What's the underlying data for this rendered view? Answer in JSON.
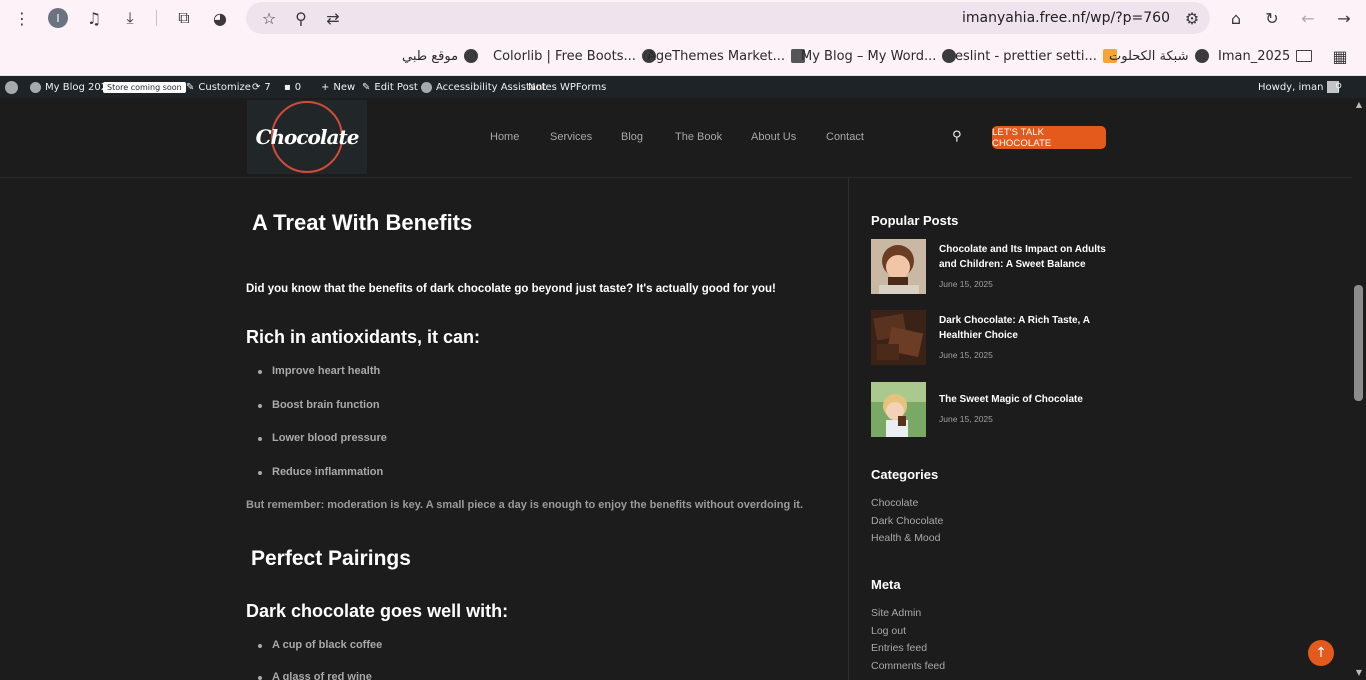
{
  "browser": {
    "profile_initial": "I",
    "url": "imanyahia.free.nf/wp/?p=760",
    "icons": [
      "menu-icon",
      "profile-icon",
      "media-icon",
      "download-icon",
      "extensions-icon",
      "globe-extension-icon",
      "star-icon",
      "zoom-icon",
      "translate-icon",
      "site-settings-icon",
      "home-icon",
      "reload-icon",
      "back-icon",
      "forward-icon",
      "apps-grid-icon"
    ]
  },
  "bookmarks": [
    {
      "label": "موقع طبي"
    },
    {
      "label": "Colorlib | Free Boots..."
    },
    {
      "label": "AgeThemes Market..."
    },
    {
      "label": "My Blog – My Word..."
    },
    {
      "label": "eslint - prettier setti..."
    },
    {
      "label": "شبكة الكحلوت"
    },
    {
      "label": "Iman_2025"
    }
  ],
  "adminbar": {
    "site_name": "My Blog 2025",
    "store_badge": "Store coming soon",
    "customize": "Customize",
    "updates_count": "7",
    "comments_count": "0",
    "new": "New",
    "edit_post": "Edit Post",
    "accessibility": "Accessibility Assistant",
    "notes": "Notes",
    "wpforms": "WPForms",
    "howdy": "Howdy, iman"
  },
  "header": {
    "logo_text": "Chocolate",
    "nav": [
      "Home",
      "Services",
      "Blog",
      "The Book",
      "About Us",
      "Contact"
    ],
    "cta": "LET'S TALK CHOCOLATE"
  },
  "article": {
    "h1": "A Treat With Benefits",
    "intro": "Did you know that the benefits of dark chocolate go beyond just taste? It's actually good for you!",
    "h_antioxidants": "Rich in antioxidants, it can:",
    "benefits": [
      "Improve heart health",
      "Boost brain function",
      "Lower blood pressure",
      "Reduce inflammation"
    ],
    "moderation": "But remember: moderation is key. A small piece a day is enough to enjoy the benefits without overdoing it.",
    "h_pairings": "Perfect Pairings",
    "h_goes_with": "Dark chocolate goes well with:",
    "pairings": [
      "A cup of black coffee",
      "A glass of red wine"
    ]
  },
  "sidebar": {
    "popular_title": "Popular Posts",
    "posts": [
      {
        "title": "Chocolate and Its Impact on Adults and Children: A Sweet Balance",
        "date": "June 15, 2025"
      },
      {
        "title": "Dark Chocolate: A Rich Taste, A Healthier Choice",
        "date": "June 15, 2025"
      },
      {
        "title": "The Sweet Magic of Chocolate",
        "date": "June 15, 2025"
      }
    ],
    "categories_title": "Categories",
    "categories": [
      "Chocolate",
      "Dark Chocolate",
      "Health & Mood"
    ],
    "meta_title": "Meta",
    "meta": [
      "Site Admin",
      "Log out",
      "Entries feed",
      "Comments feed"
    ]
  },
  "colors": {
    "accent": "#e35a1c",
    "page_bg": "#1c1c1c",
    "adminbar_bg": "#1d2327",
    "browser_bg": "#fdf2f8"
  }
}
